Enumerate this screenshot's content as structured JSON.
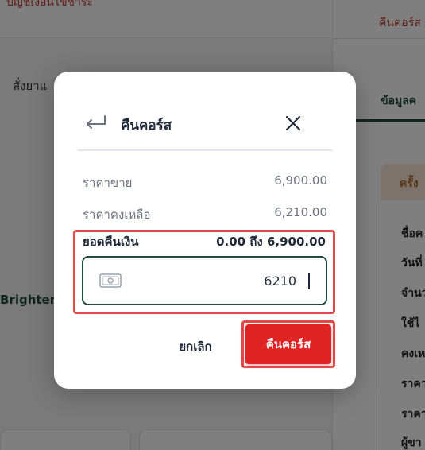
{
  "background": {
    "top_text": "บัญชีเงื่อนไขชำระ",
    "tab_order": "สั่งยาแ",
    "product_name": "Brighten",
    "right_top_link": "คืนคอร์ส",
    "right_tab": "ข้อมูลค",
    "right_card_header": "ครั้ง",
    "right_rows": [
      "ชื่อค",
      "วันที่",
      "จำนว",
      "ใช้ไ",
      "คงเห",
      "ราคา",
      "ราคา",
      "ผู้ขา"
    ]
  },
  "modal": {
    "title": "คืนคอร์ส",
    "sale_price_label": "ราคาขาย",
    "sale_price_value": "6,900.00",
    "remaining_label": "ราคาคงเหลือ",
    "remaining_value": "6,210.00",
    "refund_label": "ยอดคืนเงิน",
    "refund_range": "0.00 ถึง 6,900.00",
    "refund_input_value": "6210",
    "cancel_label": "ยกเลิก",
    "confirm_label": "คืนคอร์ส"
  },
  "colors": {
    "accent_green": "#1d4b3a",
    "danger_red": "#e02424",
    "highlight_border": "#e54848"
  },
  "icons": {
    "return": "return-arrow-icon",
    "close": "close-icon",
    "money": "money-icon"
  }
}
